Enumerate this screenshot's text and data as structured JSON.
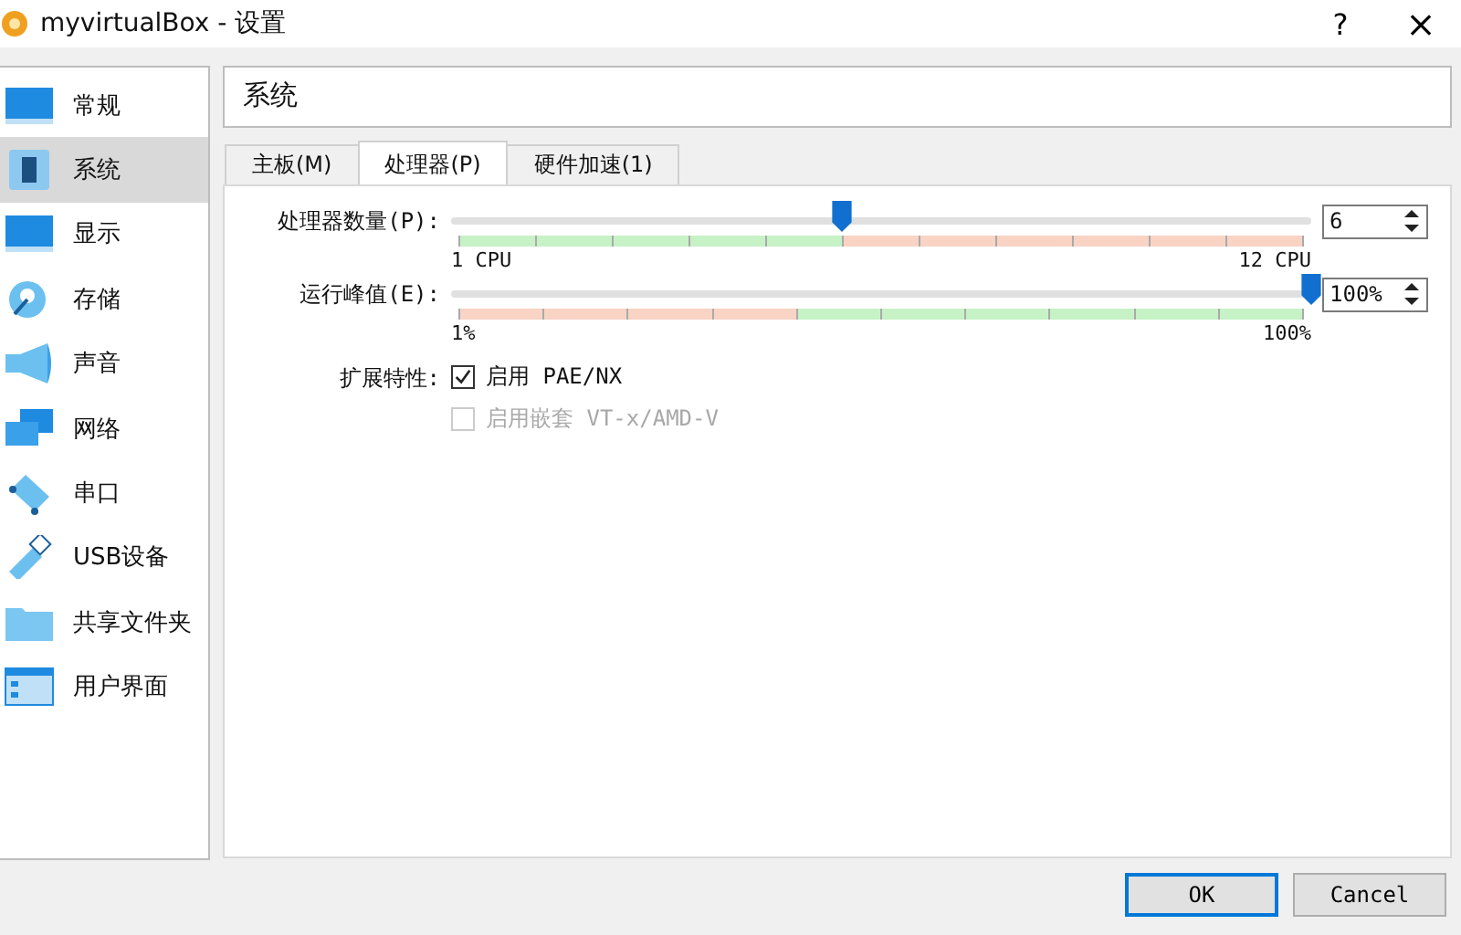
{
  "window": {
    "title": "myvirtualBox - 设置",
    "help": "?",
    "close": "×"
  },
  "sidebar": {
    "items": [
      {
        "label": "常规",
        "selected": false
      },
      {
        "label": "系统",
        "selected": true
      },
      {
        "label": "显示",
        "selected": false
      },
      {
        "label": "存储",
        "selected": false
      },
      {
        "label": "声音",
        "selected": false
      },
      {
        "label": "网络",
        "selected": false
      },
      {
        "label": "串口",
        "selected": false
      },
      {
        "label": "USB设备",
        "selected": false
      },
      {
        "label": "共享文件夹",
        "selected": false
      },
      {
        "label": "用户界面",
        "selected": false
      }
    ]
  },
  "page_title": "系统",
  "tabs": [
    {
      "label": "主板(M)",
      "selected": false
    },
    {
      "label": "处理器(P)",
      "selected": true
    },
    {
      "label": "硬件加速(1)",
      "selected": false
    }
  ],
  "sliders": [
    {
      "label": "处理器数量(P):",
      "level": 0.4545,
      "value": "6",
      "min_label": "1 CPU",
      "max_label": "12 CPU",
      "scale": [
        {
          "color": "#c6f2c6"
        },
        {
          "color": "#c6f2c6"
        },
        {
          "color": "#c6f2c6"
        },
        {
          "color": "#c6f2c6"
        },
        {
          "color": "#c6f2c6"
        },
        {
          "color": "#f9d3c4"
        },
        {
          "color": "#f9d3c4"
        },
        {
          "color": "#f9d3c4"
        },
        {
          "color": "#f9d3c4"
        },
        {
          "color": "#f9d3c4"
        },
        {
          "color": "#f9d3c4"
        }
      ]
    },
    {
      "label": "运行峰值(E):",
      "level": 1,
      "value": "100%",
      "min_label": "1%",
      "max_label": "100%",
      "scale": [
        {
          "color": "#f9d3c4"
        },
        {
          "color": "#f9d3c4"
        },
        {
          "color": "#f9d3c4"
        },
        {
          "color": "#f9d3c4"
        },
        {
          "color": "#c6f2c6"
        },
        {
          "color": "#c6f2c6"
        },
        {
          "color": "#c6f2c6"
        },
        {
          "color": "#c6f2c6"
        },
        {
          "color": "#c6f2c6"
        },
        {
          "color": "#c6f2c6"
        }
      ]
    }
  ],
  "extended": {
    "label": "扩展特性:",
    "options": [
      {
        "label": "启用 PAE/NX",
        "checked": true,
        "disabled": false
      },
      {
        "label": "启用嵌套 VT-x/AMD-V",
        "checked": false,
        "disabled": true
      }
    ]
  },
  "buttons": [
    {
      "label": "OK",
      "selected": true
    },
    {
      "label": "Cancel",
      "selected": false
    }
  ]
}
